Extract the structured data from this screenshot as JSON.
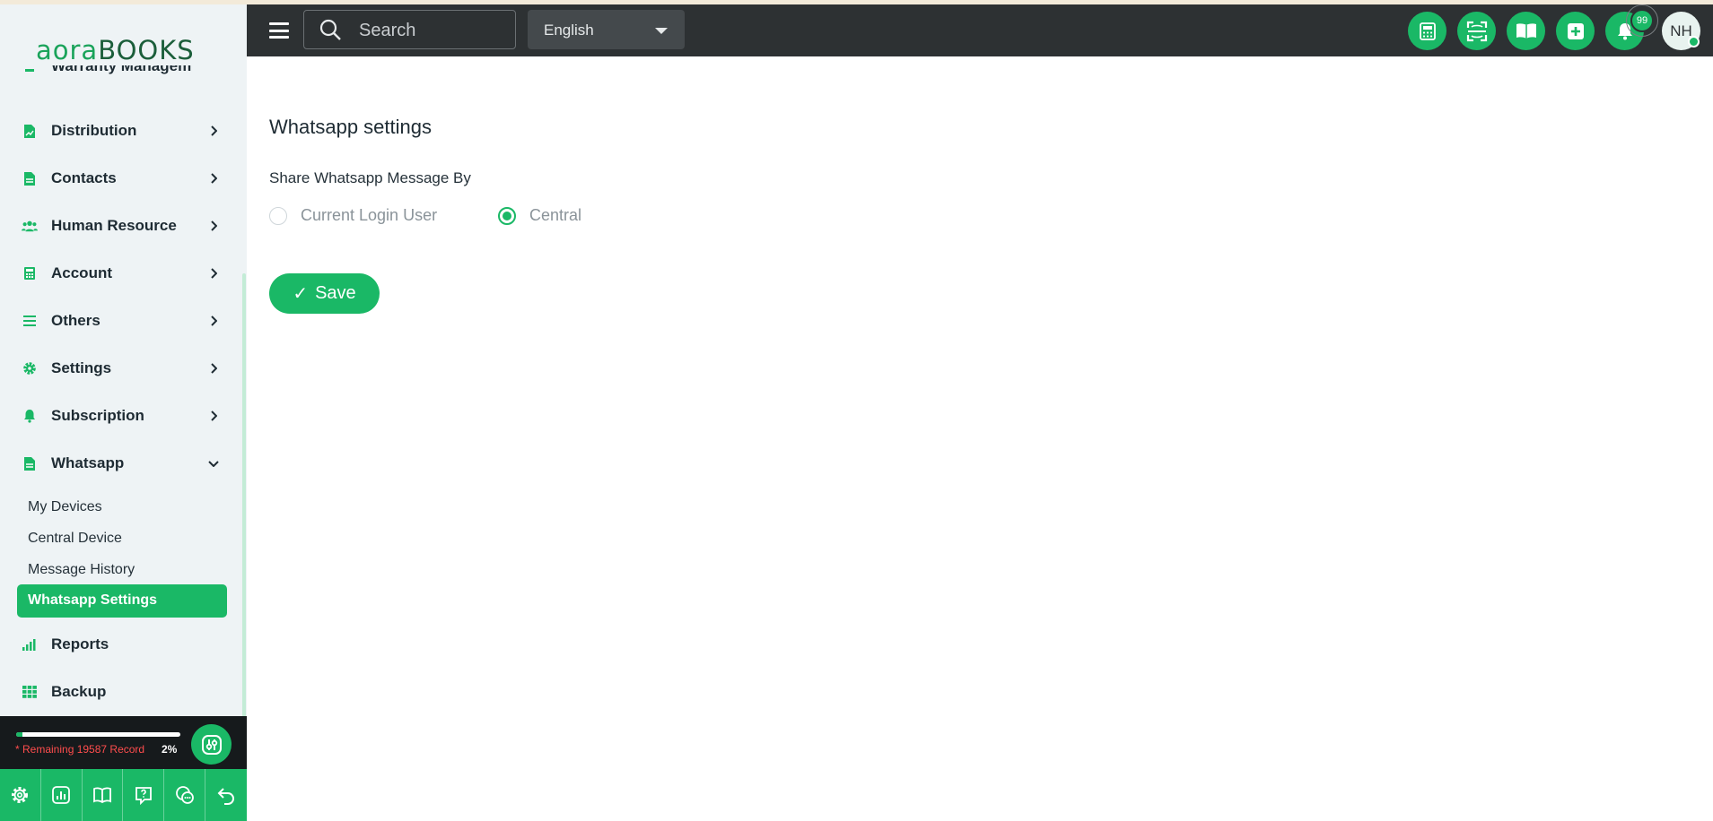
{
  "brand": {
    "logo_part1": "aora",
    "logo_part2": "BOOKS",
    "accent_color": "#1ab866"
  },
  "header": {
    "search_placeholder": "Search",
    "language": "English",
    "notification_count": "99",
    "user_initials": "NH",
    "action_icons": [
      "calculator-icon",
      "scan-icon",
      "book-open-icon",
      "plus-square-icon",
      "bell-icon"
    ]
  },
  "sidebar": {
    "partial_item": "Warranty Managem",
    "items": [
      {
        "label": "Distribution",
        "icon": "file-chart-icon"
      },
      {
        "label": "Contacts",
        "icon": "file-icon"
      },
      {
        "label": "Human Resource",
        "icon": "users-icon"
      },
      {
        "label": "Account",
        "icon": "calculator-icon"
      },
      {
        "label": "Others",
        "icon": "list-icon"
      },
      {
        "label": "Settings",
        "icon": "gear-icon"
      },
      {
        "label": "Subscription",
        "icon": "bell-icon"
      },
      {
        "label": "Whatsapp",
        "icon": "file-icon",
        "expanded": true
      }
    ],
    "whatsapp_sub": [
      "My Devices",
      "Central Device",
      "Message History",
      "Whatsapp Settings"
    ],
    "active_sub": "Whatsapp Settings",
    "items_after": [
      {
        "label": "Reports",
        "icon": "bar-chart-icon"
      },
      {
        "label": "Backup",
        "icon": "grid-icon"
      }
    ]
  },
  "records": {
    "text": "* Remaining 19587 Record",
    "percent_label": "2%",
    "percent": 2
  },
  "bottom_bar_icons": [
    "gear-icon",
    "chart-icon",
    "book-icon",
    "help-icon",
    "chat-icon",
    "undo-icon"
  ],
  "main": {
    "title": "Whatsapp settings",
    "field_label": "Share Whatsapp Message By",
    "options": [
      {
        "label": "Current Login User",
        "checked": false
      },
      {
        "label": "Central",
        "checked": true
      }
    ],
    "save_label": "Save",
    "save_glyph": "✓"
  }
}
